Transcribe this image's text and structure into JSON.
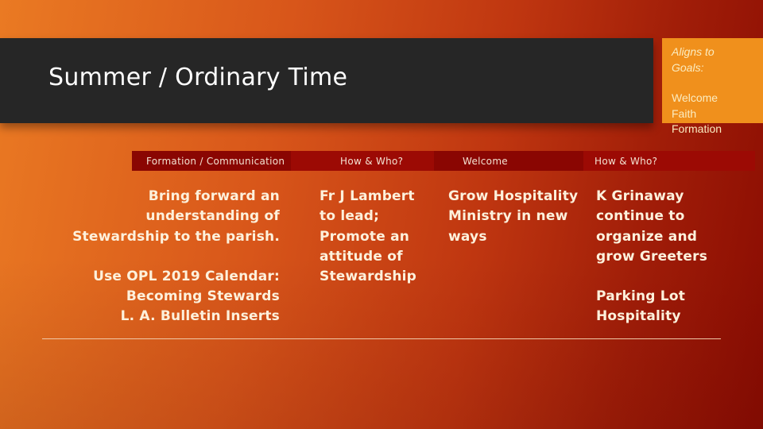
{
  "slide": {
    "title": "Summer / Ordinary Time",
    "goals": {
      "heading": [
        "Aligns to",
        "Goals:"
      ],
      "items": [
        "Welcome",
        "Faith",
        "Formation"
      ]
    },
    "table": {
      "headers": [
        "Formation / Communication",
        "How & Who?",
        "Welcome",
        "How & Who?"
      ],
      "columns": [
        {
          "paragraphs": [
            "Bring forward an\nunderstanding of\nStewardship to the parish.",
            "Use OPL 2019 Calendar:\nBecoming Stewards\nL. A. Bulletin Inserts"
          ]
        },
        {
          "paragraphs": [
            "Fr J Lambert\nto lead;\nPromote an\nattitude of\nStewardship"
          ]
        },
        {
          "paragraphs": [
            "Grow Hospitality\nMinistry in new\nways"
          ]
        },
        {
          "paragraphs": [
            "K Grinaway\ncontinue to\norganize and\ngrow Greeters",
            "Parking Lot\nHospitality"
          ]
        }
      ]
    },
    "colors": {
      "title_bar": "#262626",
      "goals_box": "#f0901c",
      "header_row": "#9c0a04",
      "text": "#fdf1dc"
    }
  }
}
